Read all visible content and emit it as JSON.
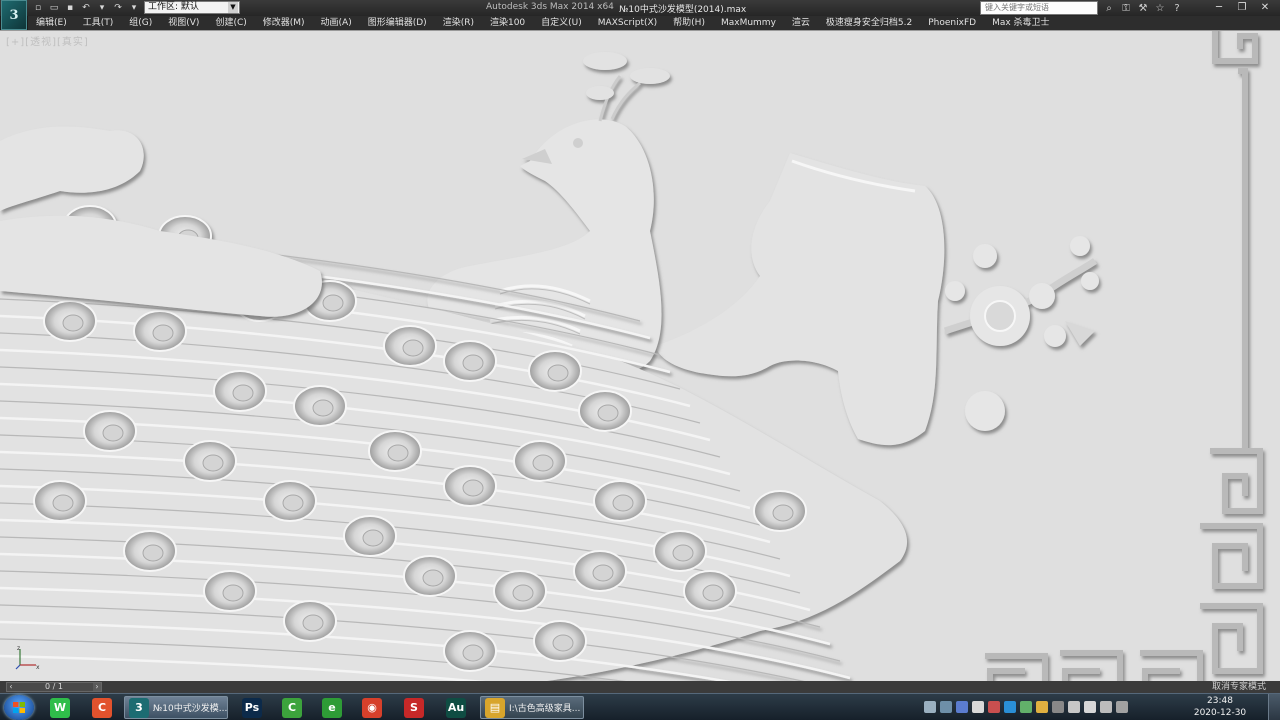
{
  "titlebar": {
    "workspace_label": "工作区: 默认",
    "app_title": "Autodesk 3ds Max  2014 x64",
    "doc_title": "№10中式沙发模型(2014).max",
    "search_placeholder": "键入关键字或短语",
    "qat_icons": [
      "new-icon",
      "open-icon",
      "save-icon",
      "undo-icon",
      "redo-icon",
      "hold-icon"
    ],
    "search_tools": [
      "binoculars-icon",
      "key-icon",
      "tools-icon",
      "star-icon",
      "help-icon"
    ],
    "window_controls": [
      "minimize-icon",
      "restore-icon",
      "close-icon"
    ]
  },
  "menu": {
    "items": [
      "编辑(E)",
      "工具(T)",
      "组(G)",
      "视图(V)",
      "创建(C)",
      "修改器(M)",
      "动画(A)",
      "图形编辑器(D)",
      "渲染(R)",
      "渲染100",
      "自定义(U)",
      "MAXScript(X)",
      "帮助(H)",
      "MaxMummy",
      "渲云",
      "极速瘦身安全归档5.2",
      "PhoenixFD",
      "Max 杀毒卫士"
    ]
  },
  "viewport": {
    "label": "[+][透视][真实]",
    "background": "#dedede"
  },
  "status": {
    "frame_counter": "0 / 1",
    "message": "取消专家模式"
  },
  "taskbar": {
    "apps": [
      {
        "name": "wechat",
        "short": "W",
        "color": "#2fbd4a"
      },
      {
        "name": "cuantao",
        "short": "C",
        "color": "#e2522d"
      },
      {
        "name": "3dsmax",
        "short": "3",
        "color": "#1c6c72",
        "label": "№10中式沙发模..."
      },
      {
        "name": "photoshop",
        "short": "Ps",
        "color": "#0c2a4a"
      },
      {
        "name": "camtasia",
        "short": "C",
        "color": "#3ca33c"
      },
      {
        "name": "360",
        "short": "e",
        "color": "#2e9c36"
      },
      {
        "name": "chrome",
        "short": "◉",
        "color": "#d6402b"
      },
      {
        "name": "sketchup",
        "short": "S",
        "color": "#c62828"
      },
      {
        "name": "audition",
        "short": "Au",
        "color": "#0f4d43"
      },
      {
        "name": "explorer",
        "short": "▤",
        "color": "#d8a52c",
        "label": "I:\\古色高级家具..."
      }
    ],
    "tray_colors": [
      "#9ab0c0",
      "#6e8fa8",
      "#5b7ccf",
      "#d9d9d9",
      "#c84f4f",
      "#2a8fd6",
      "#62b06a",
      "#e0b040",
      "#888888",
      "#c7c7c7",
      "#d7d7d7",
      "#bcbcbc",
      "#a2a2a2"
    ],
    "clock_time": "23:48",
    "clock_date": "2020-12-30"
  }
}
